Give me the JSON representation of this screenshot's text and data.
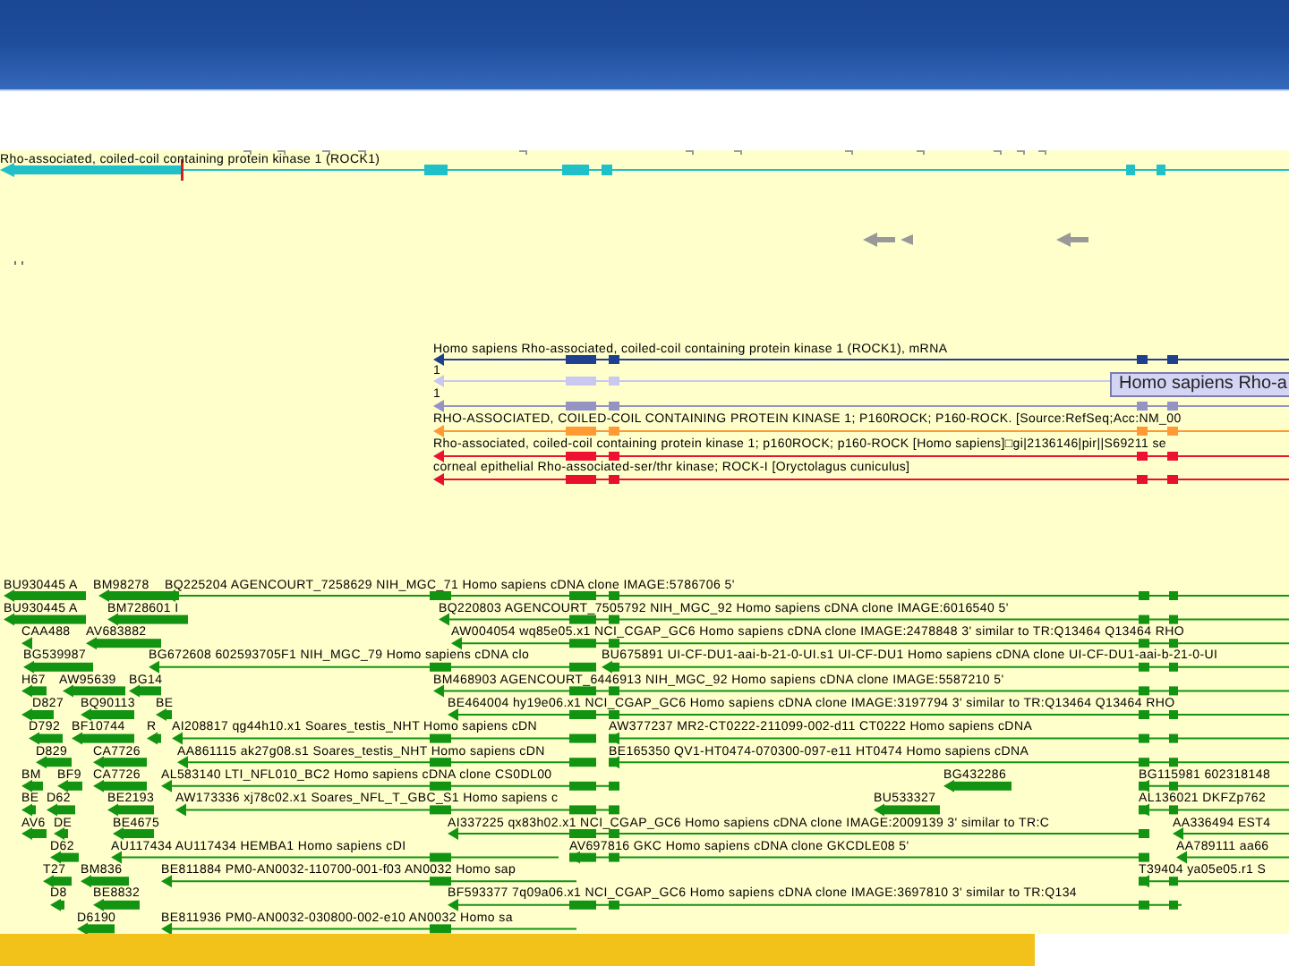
{
  "gene_track": {
    "label": "Rho-associated, coiled-coil containing protein kinase 1 (ROCK1)"
  },
  "transcript_tracks": [
    {
      "label": "Homo sapiens Rho-associated, coiled-coil containing protein kinase 1 (ROCK1), mRNA",
      "color": "#1f3f8f"
    },
    {
      "label": "1",
      "color": "#c8c8f0"
    },
    {
      "label": "1",
      "color": "#9494c4"
    },
    {
      "label": "RHO-ASSOCIATED, COILED-COIL CONTAINING PROTEIN KINASE 1; P160ROCK; P160-ROCK. [Source:RefSeq;Acc:NM_00",
      "color": "#ff9933"
    },
    {
      "label": "Rho-associated, coiled-coil containing protein kinase 1; p160ROCK; p160-ROCK [Homo sapiens]□gi|2136146|pir||S69211 se",
      "color": "#ee1133"
    },
    {
      "label": "corneal epithelial Rho-associated-ser/thr kinase; ROCK-I [Oryctolagus cuniculus]",
      "color": "#e8102c"
    }
  ],
  "tooltip": {
    "text": "Homo sapiens Rho-a"
  },
  "est_rows": [
    {
      "features": [
        {
          "label": "BU930445 A"
        },
        {
          "label": "BM98278"
        },
        {
          "label": "BQ225204 AGENCOURT_7258629 NIH_MGC_71 Homo sapiens cDNA clone IMAGE:5786706 5'"
        }
      ]
    },
    {
      "features": [
        {
          "label": "BU930445 A"
        },
        {
          "label": "BM728601 I"
        },
        {
          "label": "BQ220803 AGENCOURT_7505792 NIH_MGC_92 Homo sapiens cDNA clone IMAGE:6016540 5'"
        }
      ]
    },
    {
      "features": [
        {
          "label": "CAA488"
        },
        {
          "label": "AV683882"
        },
        {
          "label": "AW004054 wq85e05.x1 NCI_CGAP_GC6 Homo sapiens cDNA clone IMAGE:2478848 3' similar to TR:Q13464 Q13464 RHO"
        }
      ]
    },
    {
      "features": [
        {
          "label": "BG539987"
        },
        {
          "label": "BG672608 602593705F1 NIH_MGC_79 Homo sapiens cDNA clo"
        },
        {
          "label": "BU675891 UI-CF-DU1-aai-b-21-0-UI.s1 UI-CF-DU1 Homo sapiens cDNA clone UI-CF-DU1-aai-b-21-0-UI"
        }
      ]
    },
    {
      "features": [
        {
          "label": "H67"
        },
        {
          "label": "AW95639"
        },
        {
          "label": "BG14"
        },
        {
          "label": "BM468903 AGENCOURT_6446913 NIH_MGC_92 Homo sapiens cDNA clone IMAGE:5587210 5'"
        }
      ]
    },
    {
      "features": [
        {
          "label": "D827"
        },
        {
          "label": "BQ90113"
        },
        {
          "label": "BE"
        },
        {
          "label": "BE464004 hy19e06.x1 NCI_CGAP_GC6 Homo sapiens cDNA clone IMAGE:3197794 3' similar to TR:Q13464 Q13464 RHO"
        }
      ]
    },
    {
      "features": [
        {
          "label": "D792"
        },
        {
          "label": "BF10744"
        },
        {
          "label": "R"
        },
        {
          "label": "AI208817 qg44h10.x1 Soares_testis_NHT Homo sapiens cDN"
        },
        {
          "label": "AW377237 MR2-CT0222-211099-002-d11 CT0222 Homo sapiens cDNA"
        }
      ]
    },
    {
      "features": [
        {
          "label": "D829"
        },
        {
          "label": "CA7726"
        },
        {
          "label": "AA861115 ak27g08.s1 Soares_testis_NHT Homo sapiens cDN"
        },
        {
          "label": "BE165350 QV1-HT0474-070300-097-e11 HT0474 Homo sapiens cDNA"
        }
      ]
    },
    {
      "features": [
        {
          "label": "BM"
        },
        {
          "label": "BF9"
        },
        {
          "label": "CA7726"
        },
        {
          "label": "AL583140 LTI_NFL010_BC2 Homo sapiens cDNA clone CS0DL00"
        },
        {
          "label": "BG432286"
        },
        {
          "label": "BG115981 602318148"
        }
      ]
    },
    {
      "features": [
        {
          "label": "BE"
        },
        {
          "label": "D62"
        },
        {
          "label": "BE2193"
        },
        {
          "label": "AW173336 xj78c02.x1 Soares_NFL_T_GBC_S1 Homo sapiens c"
        },
        {
          "label": "BU533327"
        },
        {
          "label": "AL136021 DKFZp762"
        }
      ]
    },
    {
      "features": [
        {
          "label": "AV6"
        },
        {
          "label": "DE"
        },
        {
          "label": "BE4675"
        },
        {
          "label": "AI337225 qx83h02.x1 NCI_CGAP_GC6 Homo sapiens cDNA clone IMAGE:2009139 3' similar to TR:C"
        },
        {
          "label": "AA336494 EST4"
        }
      ]
    },
    {
      "features": [
        {
          "label": "D62"
        },
        {
          "label": "AU117434 AU117434 HEMBA1 Homo sapiens cDI"
        },
        {
          "label": "AV697816 GKC Homo sapiens cDNA clone GKCDLE08 5'"
        },
        {
          "label": "AA789111 aa66"
        }
      ]
    },
    {
      "features": [
        {
          "label": "T27"
        },
        {
          "label": "BM836"
        },
        {
          "label": "BE811884 PM0-AN0032-110700-001-f03 AN0032 Homo sap"
        },
        {
          "label": "T39404 ya05e05.r1 S"
        }
      ]
    },
    {
      "features": [
        {
          "label": "D8"
        },
        {
          "label": "BE8832"
        },
        {
          "label": "BF593377 7q09a06.x1 NCI_CGAP_GC6 Homo sapiens cDNA clone IMAGE:3697810 3' similar to TR:Q134"
        }
      ]
    },
    {
      "features": [
        {
          "label": "D6190"
        },
        {
          "label": "BE811936 PM0-AN0032-030800-002-e10 AN0032 Homo sa"
        }
      ]
    }
  ]
}
